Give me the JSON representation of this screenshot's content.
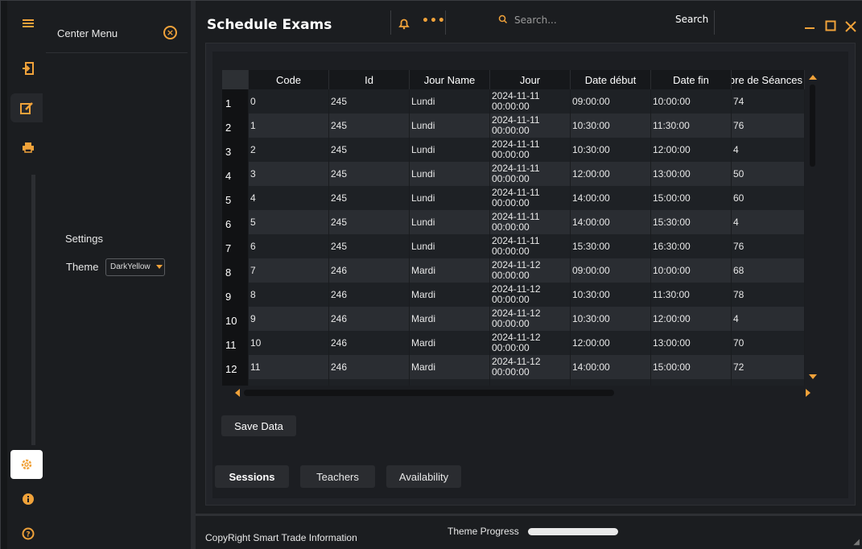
{
  "center_menu": {
    "title": "Center Menu",
    "settings_label": "Settings",
    "theme_label": "Theme",
    "theme_value": "DarkYellow"
  },
  "header": {
    "title": "Schedule Exams",
    "search_placeholder": "Search...",
    "search_button": "Search"
  },
  "table": {
    "columns": [
      "Code",
      "Id",
      "Jour Name",
      "Jour",
      "Date début",
      "Date fin",
      "Nombre de Séances"
    ],
    "rows": [
      {
        "n": "1",
        "code": "0",
        "id": "245",
        "jour_name": "Lundi",
        "jour_date": "2024-11-11",
        "jour_time": "00:00:00",
        "debut": "09:00:00",
        "fin": "10:00:00",
        "nb": "74"
      },
      {
        "n": "2",
        "code": "1",
        "id": "245",
        "jour_name": "Lundi",
        "jour_date": "2024-11-11",
        "jour_time": "00:00:00",
        "debut": "10:30:00",
        "fin": "11:30:00",
        "nb": "76"
      },
      {
        "n": "3",
        "code": "2",
        "id": "245",
        "jour_name": "Lundi",
        "jour_date": "2024-11-11",
        "jour_time": "00:00:00",
        "debut": "10:30:00",
        "fin": "12:00:00",
        "nb": "4"
      },
      {
        "n": "4",
        "code": "3",
        "id": "245",
        "jour_name": "Lundi",
        "jour_date": "2024-11-11",
        "jour_time": "00:00:00",
        "debut": "12:00:00",
        "fin": "13:00:00",
        "nb": "50"
      },
      {
        "n": "5",
        "code": "4",
        "id": "245",
        "jour_name": "Lundi",
        "jour_date": "2024-11-11",
        "jour_time": "00:00:00",
        "debut": "14:00:00",
        "fin": "15:00:00",
        "nb": "60"
      },
      {
        "n": "6",
        "code": "5",
        "id": "245",
        "jour_name": "Lundi",
        "jour_date": "2024-11-11",
        "jour_time": "00:00:00",
        "debut": "14:00:00",
        "fin": "15:30:00",
        "nb": "4"
      },
      {
        "n": "7",
        "code": "6",
        "id": "245",
        "jour_name": "Lundi",
        "jour_date": "2024-11-11",
        "jour_time": "00:00:00",
        "debut": "15:30:00",
        "fin": "16:30:00",
        "nb": "76"
      },
      {
        "n": "8",
        "code": "7",
        "id": "246",
        "jour_name": "Mardi",
        "jour_date": "2024-11-12",
        "jour_time": "00:00:00",
        "debut": "09:00:00",
        "fin": "10:00:00",
        "nb": "68"
      },
      {
        "n": "9",
        "code": "8",
        "id": "246",
        "jour_name": "Mardi",
        "jour_date": "2024-11-12",
        "jour_time": "00:00:00",
        "debut": "10:30:00",
        "fin": "11:30:00",
        "nb": "78"
      },
      {
        "n": "10",
        "code": "9",
        "id": "246",
        "jour_name": "Mardi",
        "jour_date": "2024-11-12",
        "jour_time": "00:00:00",
        "debut": "10:30:00",
        "fin": "12:00:00",
        "nb": "4"
      },
      {
        "n": "11",
        "code": "10",
        "id": "246",
        "jour_name": "Mardi",
        "jour_date": "2024-11-12",
        "jour_time": "00:00:00",
        "debut": "12:00:00",
        "fin": "13:00:00",
        "nb": "70"
      },
      {
        "n": "12",
        "code": "11",
        "id": "246",
        "jour_name": "Mardi",
        "jour_date": "2024-11-12",
        "jour_time": "00:00:00",
        "debut": "14:00:00",
        "fin": "15:00:00",
        "nb": "72"
      },
      {
        "n": "",
        "code": "",
        "id": "",
        "jour_name": "",
        "jour_date": "2024-11-12",
        "jour_time": "",
        "debut": "",
        "fin": "",
        "nb": ""
      }
    ]
  },
  "actions": {
    "save_label": "Save Data"
  },
  "tabs": [
    {
      "label": "Sessions",
      "active": true
    },
    {
      "label": "Teachers",
      "active": false
    },
    {
      "label": "Availability",
      "active": false
    }
  ],
  "footer": {
    "copyright": "CopyRight Smart Trade Information",
    "progress_label": "Theme Progress",
    "progress_value": 1.0
  },
  "colors": {
    "accent": "#f0a23a",
    "background": "#1b1d20",
    "row_even": "#2a2d32",
    "row_odd": "#1e2125"
  },
  "icons": {
    "rail": [
      "menu-icon",
      "login-icon",
      "edit-icon",
      "print-icon",
      "settings-icon",
      "info-icon",
      "help-icon"
    ]
  }
}
